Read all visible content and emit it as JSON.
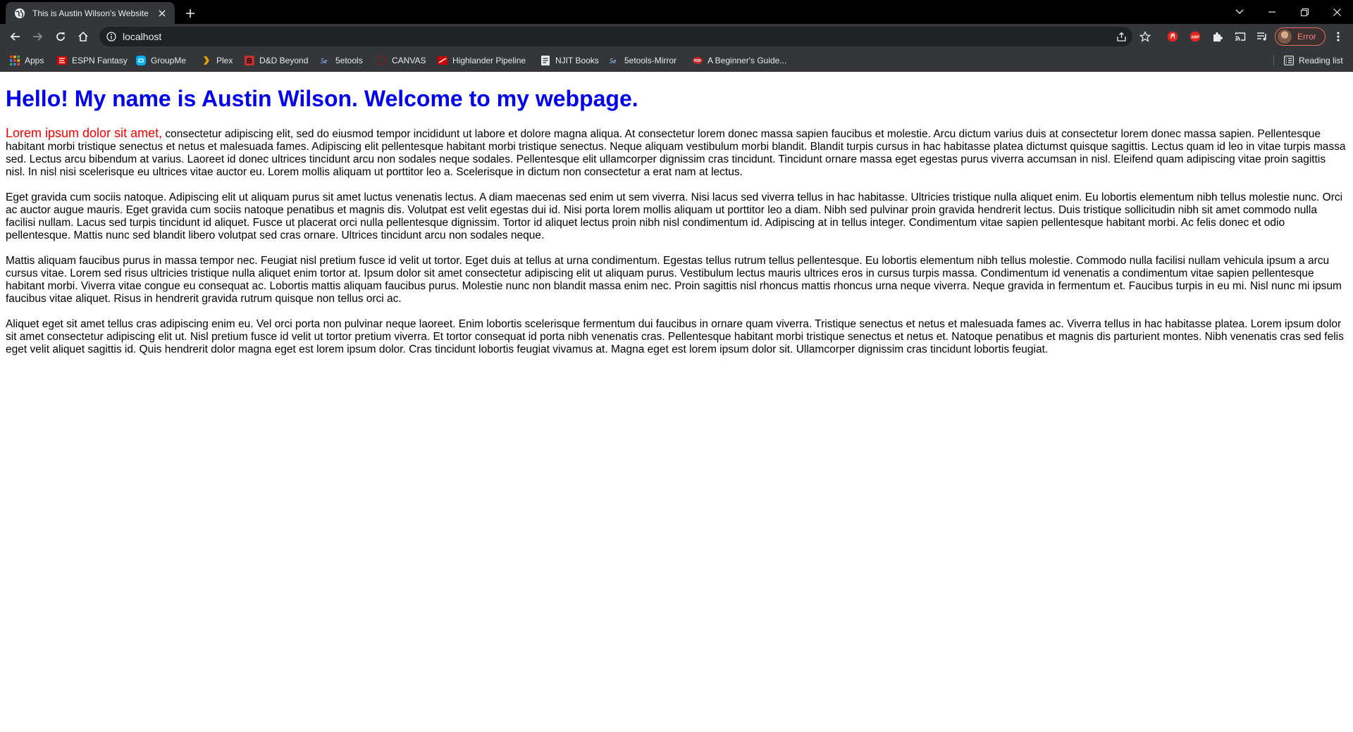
{
  "browser": {
    "tab": {
      "title": "This is Austin Wilson's Website"
    },
    "omnibox": {
      "url": "localhost"
    },
    "profile": {
      "status": "Error"
    },
    "reading_list_label": "Reading list",
    "bookmarks": [
      {
        "label": "Apps",
        "icon": "apps-grid-icon"
      },
      {
        "label": "ESPN Fantasy",
        "icon": "espn-icon"
      },
      {
        "label": "GroupMe",
        "icon": "groupme-icon"
      },
      {
        "label": "Plex",
        "icon": "plex-icon"
      },
      {
        "label": "D&D Beyond",
        "icon": "dnd-beyond-icon"
      },
      {
        "label": "5etools",
        "icon": "5etools-icon"
      },
      {
        "label": "CANVAS",
        "icon": "canvas-icon"
      },
      {
        "label": "Highlander Pipeline",
        "icon": "highlander-icon"
      },
      {
        "label": "NJIT Books",
        "icon": "document-icon"
      },
      {
        "label": "5etools-Mirror",
        "icon": "5etools-icon"
      },
      {
        "label": "A Beginner's Guide...",
        "icon": "guide-icon"
      }
    ],
    "extensions": [
      "adblock-icon",
      "abp-icon",
      "puzzle-icon"
    ],
    "colors": {
      "titlebar": "#000000",
      "toolbar": "#35363a",
      "omnibox": "#202124",
      "profile_error": "#f28b82"
    }
  },
  "page": {
    "heading": "Hello! My name is Austin Wilson. Welcome to my webpage.",
    "heading_color": "#0000ee",
    "lead_color": "#ee0000",
    "paragraphs": [
      {
        "lead": "Lorem ipsum dolor sit amet,",
        "text": " consectetur adipiscing elit, sed do eiusmod tempor incididunt ut labore et dolore magna aliqua. At consectetur lorem donec massa sapien faucibus et molestie. Arcu dictum varius duis at consectetur lorem donec massa sapien. Pellentesque habitant morbi tristique senectus et netus et malesuada fames. Adipiscing elit pellentesque habitant morbi tristique senectus. Neque aliquam vestibulum morbi blandit. Blandit turpis cursus in hac habitasse platea dictumst quisque sagittis. Lectus quam id leo in vitae turpis massa sed. Lectus arcu bibendum at varius. Laoreet id donec ultrices tincidunt arcu non sodales neque sodales. Pellentesque elit ullamcorper dignissim cras tincidunt. Tincidunt ornare massa eget egestas purus viverra accumsan in nisl. Eleifend quam adipiscing vitae proin sagittis nisl. In nisl nisi scelerisque eu ultrices vitae auctor eu. Lorem mollis aliquam ut porttitor leo a. Scelerisque in dictum non consectetur a erat nam at lectus."
      },
      {
        "text": "Eget gravida cum sociis natoque. Adipiscing elit ut aliquam purus sit amet luctus venenatis lectus. A diam maecenas sed enim ut sem viverra. Nisi lacus sed viverra tellus in hac habitasse. Ultricies tristique nulla aliquet enim. Eu lobortis elementum nibh tellus molestie nunc. Orci ac auctor augue mauris. Eget gravida cum sociis natoque penatibus et magnis dis. Volutpat est velit egestas dui id. Nisi porta lorem mollis aliquam ut porttitor leo a diam. Nibh sed pulvinar proin gravida hendrerit lectus. Duis tristique sollicitudin nibh sit amet commodo nulla facilisi nullam. Lacus sed turpis tincidunt id aliquet. Fusce ut placerat orci nulla pellentesque dignissim. Tortor id aliquet lectus proin nibh nisl condimentum id. Adipiscing at in tellus integer. Condimentum vitae sapien pellentesque habitant morbi. Ac felis donec et odio pellentesque. Mattis nunc sed blandit libero volutpat sed cras ornare. Ultrices tincidunt arcu non sodales neque."
      },
      {
        "text": "Mattis aliquam faucibus purus in massa tempor nec. Feugiat nisl pretium fusce id velit ut tortor. Eget duis at tellus at urna condimentum. Egestas tellus rutrum tellus pellentesque. Eu lobortis elementum nibh tellus molestie. Commodo nulla facilisi nullam vehicula ipsum a arcu cursus vitae. Lorem sed risus ultricies tristique nulla aliquet enim tortor at. Ipsum dolor sit amet consectetur adipiscing elit ut aliquam purus. Vestibulum lectus mauris ultrices eros in cursus turpis massa. Condimentum id venenatis a condimentum vitae sapien pellentesque habitant morbi. Viverra vitae congue eu consequat ac. Lobortis mattis aliquam faucibus purus. Molestie nunc non blandit massa enim nec. Proin sagittis nisl rhoncus mattis rhoncus urna neque viverra. Neque gravida in fermentum et. Faucibus turpis in eu mi. Nisl nunc mi ipsum faucibus vitae aliquet. Risus in hendrerit gravida rutrum quisque non tellus orci ac."
      },
      {
        "text": "Aliquet eget sit amet tellus cras adipiscing enim eu. Vel orci porta non pulvinar neque laoreet. Enim lobortis scelerisque fermentum dui faucibus in ornare quam viverra. Tristique senectus et netus et malesuada fames ac. Viverra tellus in hac habitasse platea. Lorem ipsum dolor sit amet consectetur adipiscing elit ut. Nisl pretium fusce id velit ut tortor pretium viverra. Et tortor consequat id porta nibh venenatis cras. Pellentesque habitant morbi tristique senectus et netus et. Natoque penatibus et magnis dis parturient montes. Nibh venenatis cras sed felis eget velit aliquet sagittis id. Quis hendrerit dolor magna eget est lorem ipsum dolor. Cras tincidunt lobortis feugiat vivamus at. Magna eget est lorem ipsum dolor sit. Ullamcorper dignissim cras tincidunt lobortis feugiat."
      }
    ]
  }
}
